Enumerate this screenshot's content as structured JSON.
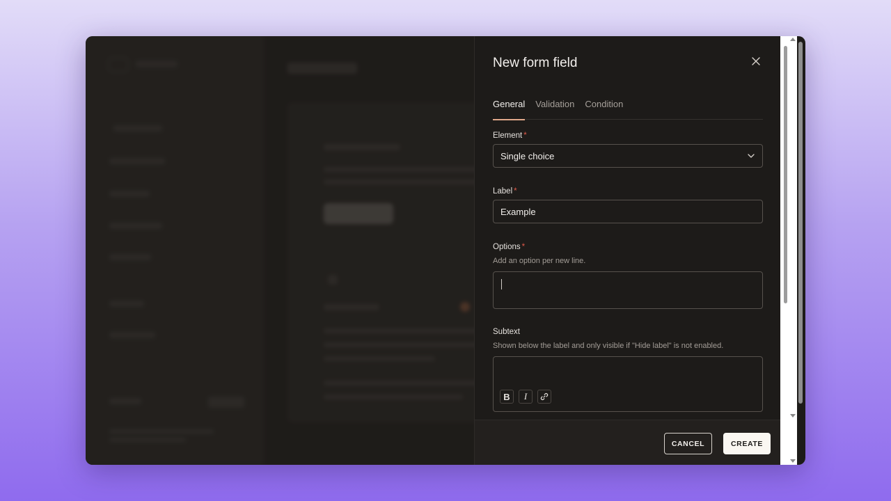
{
  "sheet": {
    "title": "New form field",
    "tabs": [
      {
        "label": "General",
        "active": true
      },
      {
        "label": "Validation",
        "active": false
      },
      {
        "label": "Condition",
        "active": false
      }
    ]
  },
  "form": {
    "element": {
      "label": "Element",
      "required_mark": "*",
      "value": "Single choice"
    },
    "label": {
      "label": "Label",
      "required_mark": "*",
      "value": "Example"
    },
    "options": {
      "label": "Options",
      "required_mark": "*",
      "help": "Add an option per new line.",
      "value": ""
    },
    "subtext": {
      "label": "Subtext",
      "help": "Shown below the label and only visible if \"Hide label\" is not enabled.",
      "value": ""
    },
    "format_buttons": {
      "bold": "B",
      "italic": "I"
    }
  },
  "footer": {
    "cancel_label": "CANCEL",
    "create_label": "CREATE"
  },
  "colors": {
    "accent_tab_underline": "#e0a88a",
    "required": "#e05a4a",
    "sheet_background": "#1d1b19",
    "primary_button": "#faf7f2"
  },
  "icons": [
    "close-icon",
    "chevron-down-icon",
    "bold-icon",
    "italic-icon",
    "link-icon"
  ]
}
